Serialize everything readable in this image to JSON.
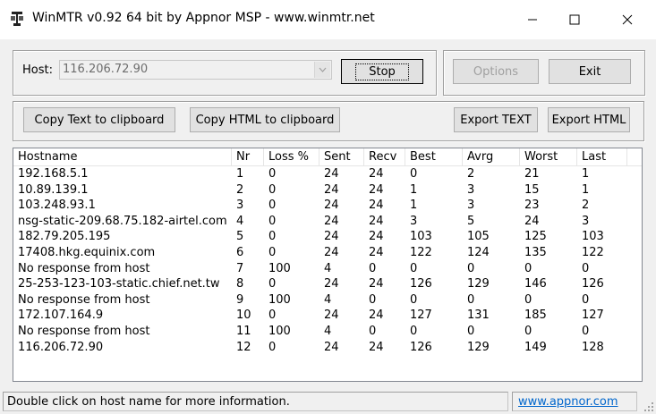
{
  "window": {
    "title": "WinMTR v0.92 64 bit by Appnor MSP - www.winmtr.net",
    "controls": [
      "minimize-icon",
      "maximize-icon",
      "close-icon"
    ]
  },
  "host": {
    "label": "Host:",
    "value": "116.206.72.90"
  },
  "buttons": {
    "stop": "Stop",
    "options": "Options",
    "exit": "Exit",
    "copy_text": "Copy Text to clipboard",
    "copy_html": "Copy HTML to clipboard",
    "export_text": "Export TEXT",
    "export_html": "Export HTML"
  },
  "table": {
    "columns": [
      "Hostname",
      "Nr",
      "Loss %",
      "Sent",
      "Recv",
      "Best",
      "Avrg",
      "Worst",
      "Last"
    ],
    "rows": [
      [
        "192.168.5.1",
        "1",
        "0",
        "24",
        "24",
        "0",
        "2",
        "21",
        "1"
      ],
      [
        "10.89.139.1",
        "2",
        "0",
        "24",
        "24",
        "1",
        "3",
        "15",
        "1"
      ],
      [
        "103.248.93.1",
        "3",
        "0",
        "24",
        "24",
        "1",
        "3",
        "23",
        "2"
      ],
      [
        "nsg-static-209.68.75.182-airtel.com",
        "4",
        "0",
        "24",
        "24",
        "3",
        "5",
        "24",
        "3"
      ],
      [
        "182.79.205.195",
        "5",
        "0",
        "24",
        "24",
        "103",
        "105",
        "125",
        "103"
      ],
      [
        "17408.hkg.equinix.com",
        "6",
        "0",
        "24",
        "24",
        "122",
        "124",
        "135",
        "122"
      ],
      [
        "No response from host",
        "7",
        "100",
        "4",
        "0",
        "0",
        "0",
        "0",
        "0"
      ],
      [
        "25-253-123-103-static.chief.net.tw",
        "8",
        "0",
        "24",
        "24",
        "126",
        "129",
        "146",
        "126"
      ],
      [
        "No response from host",
        "9",
        "100",
        "4",
        "0",
        "0",
        "0",
        "0",
        "0"
      ],
      [
        "172.107.164.9",
        "10",
        "0",
        "24",
        "24",
        "127",
        "131",
        "185",
        "127"
      ],
      [
        "No response from host",
        "11",
        "100",
        "4",
        "0",
        "0",
        "0",
        "0",
        "0"
      ],
      [
        "116.206.72.90",
        "12",
        "0",
        "24",
        "24",
        "126",
        "129",
        "149",
        "128"
      ]
    ]
  },
  "status": {
    "message": "Double click on host name for more information.",
    "link": "www.appnor.com"
  }
}
